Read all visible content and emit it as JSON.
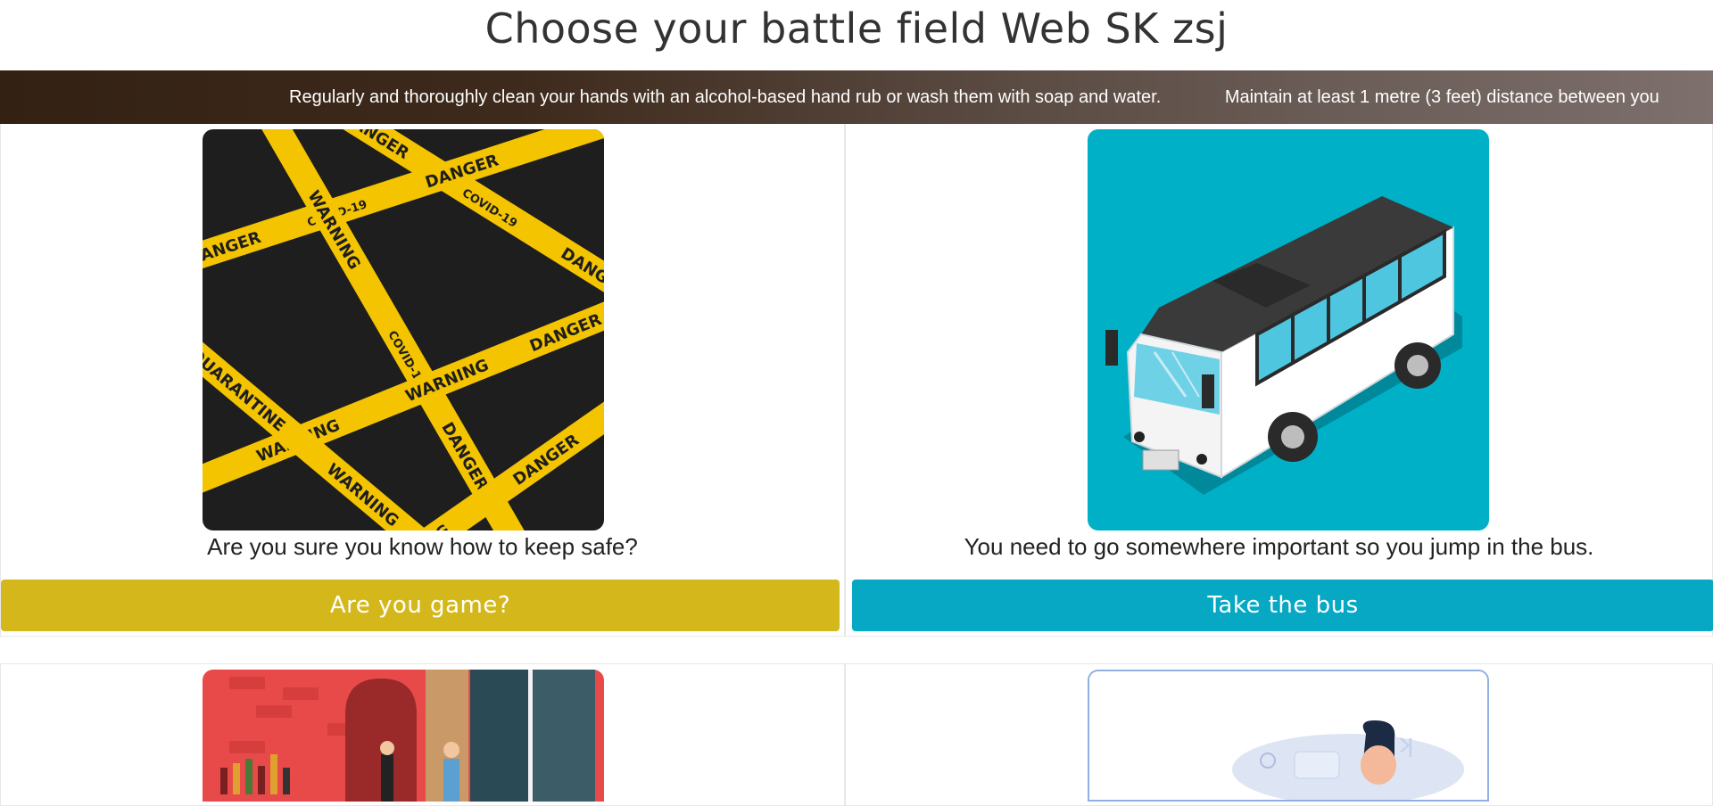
{
  "page": {
    "title": "Choose your battle field Web SK zsj"
  },
  "ticker": {
    "items": [
      "Regularly and thoroughly clean your hands with an alcohol-based hand rub or wash them with soap and water.",
      "Maintain at least 1 metre (3 feet) distance between you"
    ]
  },
  "cards": [
    {
      "image": "danger-tape-illustration",
      "text": "Are you sure you know how to keep safe?",
      "button": "Are you game?",
      "button_color": "#d4b81b"
    },
    {
      "image": "bus-illustration",
      "text": "You need to go somewhere important so you jump in the bus.",
      "button": "Take the bus",
      "button_color": "#06a8c4"
    },
    {
      "image": "bar-scene-illustration"
    },
    {
      "image": "person-illustration"
    }
  ],
  "tape_words": {
    "danger": "DANGER",
    "warning": "WARNING",
    "covid": "COVID-19",
    "quarantine": "QUARANTINE"
  },
  "colors": {
    "ticker_start": "#332114",
    "ticker_end": "#7d706d",
    "tape_yellow": "#f5c400",
    "tape_bg": "#1e1e1e",
    "bus_bg": "#00b0c6",
    "bar_bg": "#e84a4a"
  }
}
